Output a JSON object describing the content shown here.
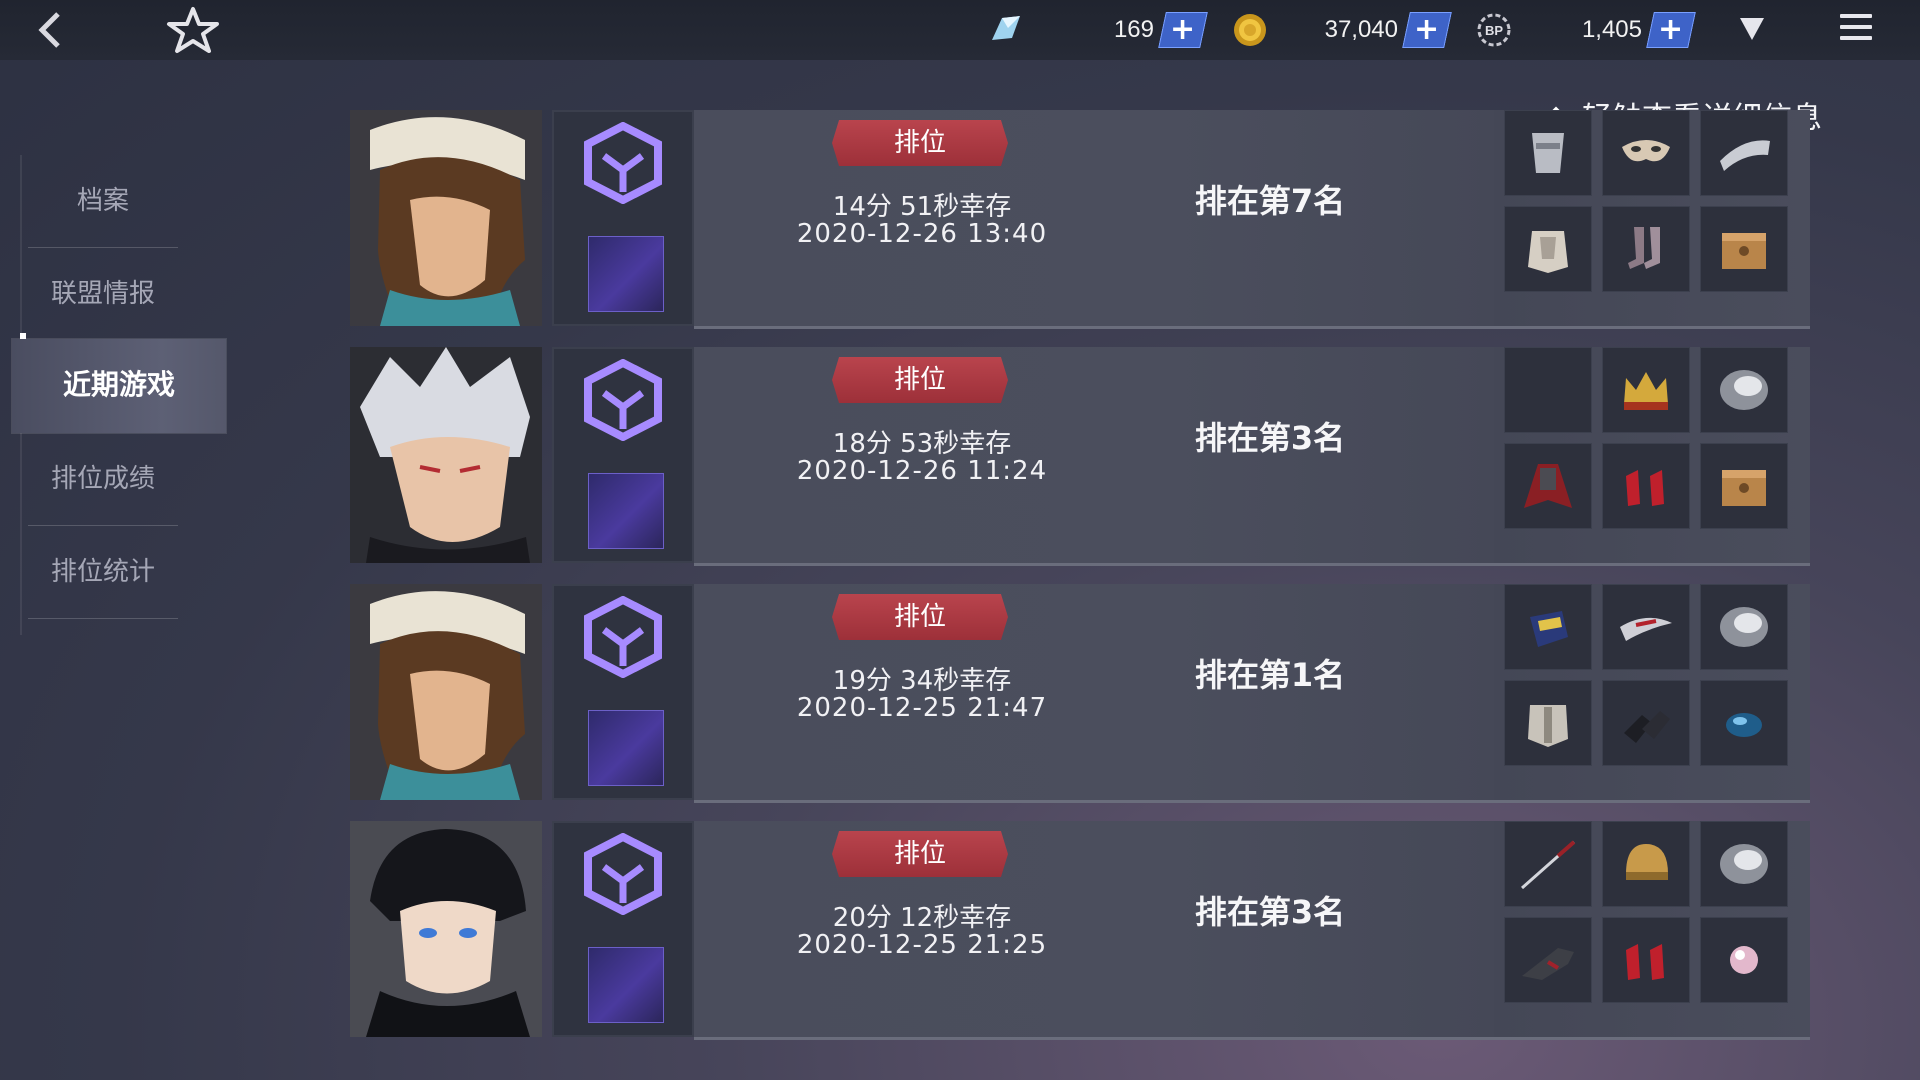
{
  "resources": [
    {
      "icon": "crystal-icon",
      "value": "169"
    },
    {
      "icon": "gold-coin-icon",
      "value": "37,040"
    },
    {
      "icon": "bp-icon",
      "value": "1,405"
    }
  ],
  "plus_label": "+",
  "hint": "轻触查看详细信息",
  "sidebar": {
    "items": [
      {
        "label": "档案"
      },
      {
        "label": "联盟情报"
      },
      {
        "label": "近期游戏",
        "active": true
      },
      {
        "label": "排位成绩"
      },
      {
        "label": "排位统计"
      }
    ]
  },
  "matches": [
    {
      "character": "brown-hair-cap-character",
      "mode": "排位",
      "survive": "14分 51秒幸存",
      "date": "2020-12-26 13:40",
      "rank": "排在第7名",
      "items": [
        "gauntlet-icon",
        "mask-icon",
        "arm-guard-icon",
        "chest-armor-icon",
        "boots-icon",
        "supply-box-icon"
      ]
    },
    {
      "character": "white-hair-character",
      "mode": "排位",
      "survive": "18分 53秒幸存",
      "date": "2020-12-26 11:24",
      "rank": "排在第3名",
      "items": [
        "empty-slot",
        "crown-icon",
        "disc-icon",
        "cape-icon",
        "red-heels-icon",
        "supply-box-icon"
      ]
    },
    {
      "character": "brown-hair-cap-character",
      "mode": "排位",
      "survive": "19分 34秒幸存",
      "date": "2020-12-25 21:47",
      "rank": "排在第1名",
      "items": [
        "glove-icon",
        "ribbon-icon",
        "disc-icon",
        "plate-armor-icon",
        "dark-boots-icon",
        "blue-orb-icon"
      ]
    },
    {
      "character": "black-hair-character",
      "mode": "排位",
      "survive": "20分 12秒幸存",
      "date": "2020-12-25 21:25",
      "rank": "排在第3名",
      "items": [
        "katana-icon",
        "helmet-icon",
        "disc-icon",
        "gun-icon",
        "red-heels-icon",
        "pearl-icon"
      ]
    }
  ]
}
